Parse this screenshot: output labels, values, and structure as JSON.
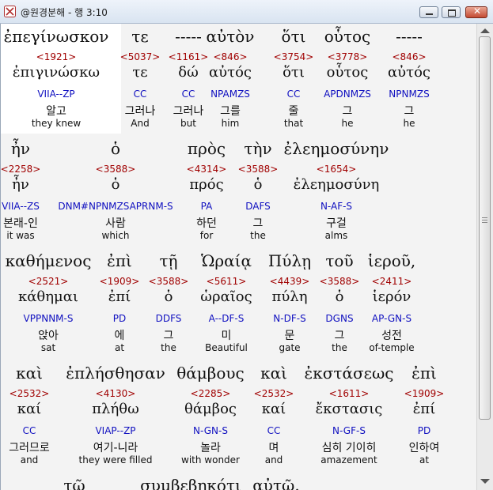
{
  "window": {
    "title": "@원경분해 - 행 3:10",
    "buttons": {
      "minimize": "minimize",
      "maximize": "maximize",
      "close": "✕"
    }
  },
  "rows": [
    {
      "words": [
        {
          "text": "ἐπεγίνωσκον",
          "num": "<1921>",
          "lemma": "ἐπιγινώσκω",
          "parse": "VIIA--ZP",
          "korean": "알고",
          "english": "they knew",
          "selected": true
        },
        {
          "text": "τε",
          "num": "<5037>",
          "lemma": "τε",
          "parse": "CC",
          "korean": "그러나",
          "english": "And"
        },
        {
          "text": "-----",
          "num": "<1161>",
          "lemma": "δώ",
          "parse": "CC",
          "korean": "그러나",
          "english": "but"
        },
        {
          "text": "αὐτὸν",
          "num": "<846>",
          "lemma": "αὐτός",
          "parse": "NPAMZS",
          "korean": "그를",
          "english": "him"
        },
        {
          "text": "ὅτι",
          "num": "<3754>",
          "lemma": "ὅτι",
          "parse": "CC",
          "korean": "줄",
          "english": "that"
        },
        {
          "text": "οὗτος",
          "num": "<3778>",
          "lemma": "οὗτος",
          "parse": "APDNMZS",
          "korean": "그",
          "english": "he"
        },
        {
          "text": "-----",
          "num": "<846>",
          "lemma": "αὐτός",
          "parse": "NPNMZS",
          "korean": "그",
          "english": "he"
        }
      ]
    },
    {
      "words": [
        {
          "text": "ἦν",
          "num": "<2258>",
          "lemma": "ἦν",
          "parse": "VIIA--ZS",
          "korean": "본래-인",
          "english": "it was"
        },
        {
          "text": "ὁ",
          "num": "<3588>",
          "lemma": "ὁ",
          "parse": "DNM#NPNMZSAPRNM-S",
          "korean": "사람",
          "english": "which"
        },
        {
          "text": "πρὸς",
          "num": "<4314>",
          "lemma": "πρός",
          "parse": "PA",
          "korean": "하던",
          "english": "for"
        },
        {
          "text": "τὴν",
          "num": "<3588>",
          "lemma": "ὁ",
          "parse": "DAFS",
          "korean": "그",
          "english": "the"
        },
        {
          "text": "ἐλεημοσύνην",
          "num": "<1654>",
          "lemma": "ἐλεημοσύνη",
          "parse": "N-AF-S",
          "korean": "구걸",
          "english": "alms"
        }
      ]
    },
    {
      "words": [
        {
          "text": "καθήμενος",
          "num": "<2521>",
          "lemma": "κάθημαι",
          "parse": "VPPNNM-S",
          "korean": "앉아",
          "english": "sat"
        },
        {
          "text": "ἐπὶ",
          "num": "<1909>",
          "lemma": "ἐπί",
          "parse": "PD",
          "korean": "에",
          "english": "at"
        },
        {
          "text": "τῇ",
          "num": "<3588>",
          "lemma": "ὁ",
          "parse": "DDFS",
          "korean": "그",
          "english": "the"
        },
        {
          "text": "Ὡραίᾳ",
          "num": "<5611>",
          "lemma": "ὡραῖος",
          "parse": "A--DF-S",
          "korean": "미",
          "english": "Beautiful"
        },
        {
          "text": "Πύλῃ",
          "num": "<4439>",
          "lemma": "πύλη",
          "parse": "N-DF-S",
          "korean": "문",
          "english": "gate"
        },
        {
          "text": "τοῦ",
          "num": "<3588>",
          "lemma": "ὁ",
          "parse": "DGNS",
          "korean": "그",
          "english": "the"
        },
        {
          "text": "ἱεροῦ,",
          "num": "<2411>",
          "lemma": "ἱερόν",
          "parse": "AP-GN-S",
          "korean": "성전",
          "english": "of-temple"
        }
      ]
    },
    {
      "words": [
        {
          "text": "καὶ",
          "num": "<2532>",
          "lemma": "καί",
          "parse": "CC",
          "korean": "그러므로",
          "english": "and"
        },
        {
          "text": "ἐπλήσθησαν",
          "num": "<4130>",
          "lemma": "πλήθω",
          "parse": "VIAP--ZP",
          "korean": "여기-니라",
          "english": "they were filled"
        },
        {
          "text": "θάμβους",
          "num": "<2285>",
          "lemma": "θάμβος",
          "parse": "N-GN-S",
          "korean": "놀라",
          "english": "with wonder"
        },
        {
          "text": "καὶ",
          "num": "<2532>",
          "lemma": "καί",
          "parse": "CC",
          "korean": "며",
          "english": "and"
        },
        {
          "text": "ἐκστάσεως",
          "num": "<1611>",
          "lemma": "ἔκστασις",
          "parse": "N-GF-S",
          "korean": "심히 기이히",
          "english": "amazement"
        },
        {
          "text": "ἐπὶ",
          "num": "<1909>",
          "lemma": "ἐπί",
          "parse": "PD",
          "korean": "인하여",
          "english": "at"
        }
      ]
    },
    {
      "words": [
        {
          "text": "τῷ"
        },
        {
          "text": "συμβεβηκότι"
        },
        {
          "text": "αὐτῷ."
        }
      ]
    }
  ]
}
